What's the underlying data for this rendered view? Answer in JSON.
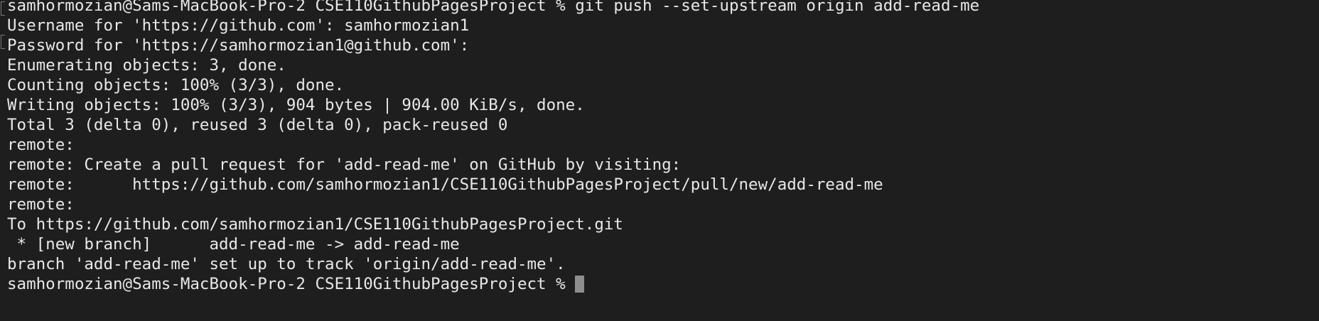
{
  "terminal": {
    "lines": [
      "samhormozian@Sams-MacBook-Pro-2 CSE110GithubPagesProject % git push --set-upstream origin add-read-me",
      "Username for 'https://github.com': samhormozian1",
      "Password for 'https://samhormozian1@github.com':",
      "Enumerating objects: 3, done.",
      "Counting objects: 100% (3/3), done.",
      "Writing objects: 100% (3/3), 904 bytes | 904.00 KiB/s, done.",
      "Total 3 (delta 0), reused 3 (delta 0), pack-reused 0",
      "remote:",
      "remote: Create a pull request for 'add-read-me' on GitHub by visiting:",
      "remote:      https://github.com/samhormozian1/CSE110GithubPagesProject/pull/new/add-read-me",
      "remote:",
      "To https://github.com/samhormozian1/CSE110GithubPagesProject.git",
      " * [new branch]      add-read-me -> add-read-me",
      "branch 'add-read-me' set up to track 'origin/add-read-me'."
    ],
    "prompt": "samhormozian@Sams-MacBook-Pro-2 CSE110GithubPagesProject % "
  }
}
